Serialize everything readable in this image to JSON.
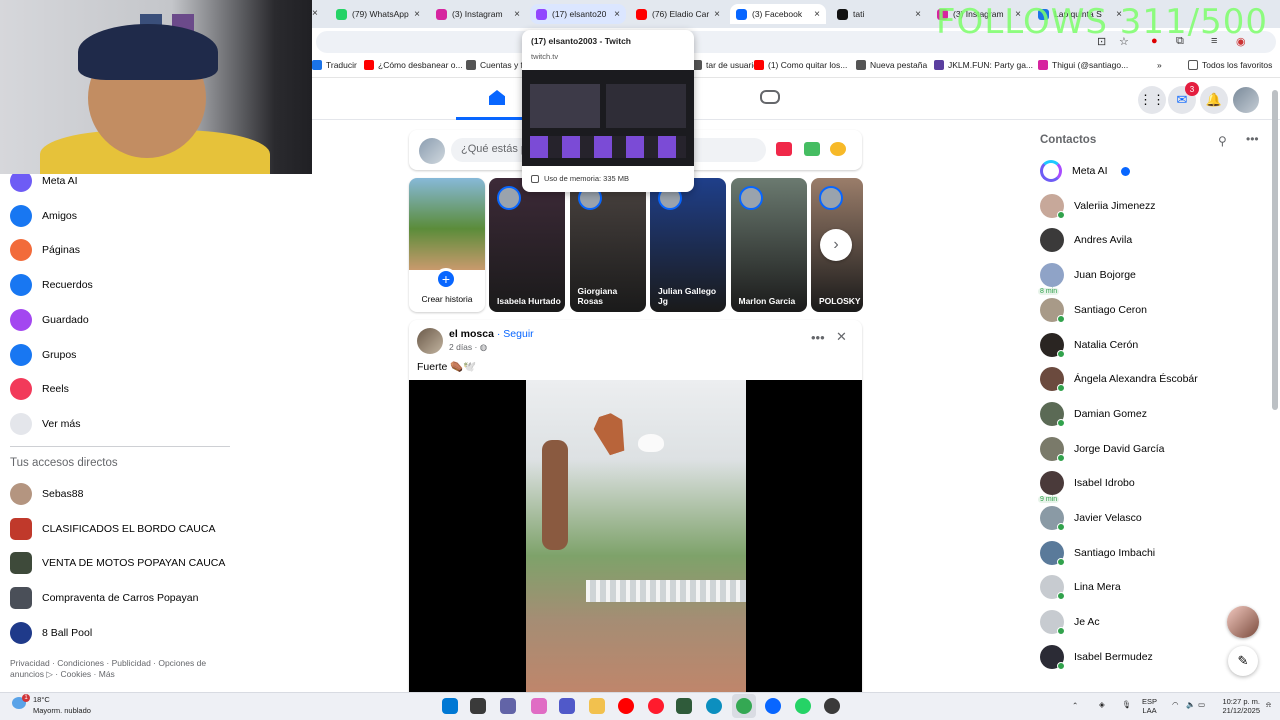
{
  "browser": {
    "tabs": [
      {
        "title": "(79) WhatsApp",
        "icon": "whatsapp-icon",
        "color": "#25d366",
        "state": "normal"
      },
      {
        "title": "(3) Instagram",
        "icon": "instagram-icon",
        "color": "#d6249f",
        "state": "normal"
      },
      {
        "title": "(17) elsanto20",
        "icon": "twitch-icon",
        "color": "#9146ff",
        "state": "hover"
      },
      {
        "title": "(76) Eladio Car",
        "icon": "youtube-icon",
        "color": "#ff0000",
        "state": "normal"
      },
      {
        "title": "(3) Facebook",
        "icon": "facebook-icon",
        "color": "#0866ff",
        "state": "active"
      },
      {
        "title": "tati",
        "icon": "tiktok-icon",
        "color": "#111111",
        "state": "normal"
      },
      {
        "title": "(3) Instagram",
        "icon": "instagram-icon",
        "color": "#d6249f",
        "state": "normal"
      },
      {
        "title": "Lap quinta S",
        "icon": "chrome-icon",
        "color": "#1a73e8",
        "state": "normal"
      }
    ],
    "tab_close": "×",
    "hover_card": {
      "title": "(17) elsanto2003 - Twitch",
      "url": "twitch.tv",
      "memory": "Uso de memoria: 335 MB"
    },
    "bookmarks": [
      {
        "label": "Traducir",
        "color": "#1a73e8"
      },
      {
        "label": "¿Cómo desbanear o...",
        "color": "#ff0000"
      },
      {
        "label": "Cuentas y fa",
        "color": "#555555"
      },
      {
        "label": "tar de usuario",
        "color": "#555555"
      },
      {
        "label": "(1) Como quitar los...",
        "color": "#ff0000"
      },
      {
        "label": "Nueva pestaña",
        "color": "#555555"
      },
      {
        "label": "JKLM.FUN: Party ga...",
        "color": "#5b3fa0"
      },
      {
        "label": "Thigui (@santiago...",
        "color": "#d6249f"
      }
    ],
    "bookmarks_more": "»",
    "all_bookmarks": "Todos los favoritos"
  },
  "overlay": {
    "follows": "FOLLOWS 311/500"
  },
  "facebook": {
    "composer_placeholder": "¿Qué estás p",
    "notification_count": "3",
    "left_nav": [
      {
        "label": "Meta AI",
        "icon": "meta-ai-icon",
        "color": "#6e5cf5"
      },
      {
        "label": "Amigos",
        "icon": "friends-icon",
        "color": "#1877f2"
      },
      {
        "label": "Páginas",
        "icon": "pages-icon",
        "color": "#f26b3a"
      },
      {
        "label": "Recuerdos",
        "icon": "memories-icon",
        "color": "#1877f2"
      },
      {
        "label": "Guardado",
        "icon": "saved-icon",
        "color": "#a347f0"
      },
      {
        "label": "Grupos",
        "icon": "groups-icon",
        "color": "#1877f2"
      },
      {
        "label": "Reels",
        "icon": "reels-icon",
        "color": "#f23a5a"
      },
      {
        "label": "Ver más",
        "icon": "chevron-down-icon",
        "color": "#e4e6eb"
      }
    ],
    "shortcuts_title": "Tus accesos directos",
    "shortcuts": [
      {
        "label": "Sebas88",
        "color": "#b49580"
      },
      {
        "label": "CLASIFICADOS EL BORDO CAUCA",
        "color": "#c0392b"
      },
      {
        "label": "VENTA DE MOTOS POPAYAN CAUCA",
        "color": "#3e4a3a"
      },
      {
        "label": "Compraventa de Carros Popayan",
        "color": "#4a4f58"
      },
      {
        "label": "8 Ball Pool",
        "color": "#1f3a8a"
      }
    ],
    "legal": "Privacidad · Condiciones · Publicidad · Opciones de anuncios ▷ · Cookies · Más",
    "stories": {
      "create_label": "Crear historia",
      "items": [
        {
          "name": "Isabela Hurtado",
          "color": "#3d2a38"
        },
        {
          "name": "Giorgiana Rosas",
          "color": "#4a4340"
        },
        {
          "name": "Julian Gallego Jg",
          "color": "#1f3f8a"
        },
        {
          "name": "Marlon Garcia",
          "color": "#6b7a70"
        },
        {
          "name": "POLOSKY",
          "color": "#9a7d6a"
        }
      ]
    },
    "post": {
      "author": "el mosca",
      "follow": "Seguir",
      "time": "2 días · ",
      "caption": "Fuerte ⚰️🕊️"
    },
    "contacts": {
      "title": "Contactos",
      "items": [
        {
          "name": "Meta AI",
          "kind": "meta",
          "color": "#6e5cf5",
          "online": false,
          "minutes": ""
        },
        {
          "name": "Valeriia Jimenezz",
          "kind": "person",
          "color": "#c7a89a",
          "online": true,
          "minutes": ""
        },
        {
          "name": "Andres Avila",
          "kind": "person",
          "color": "#3b3a3a",
          "online": false,
          "minutes": ""
        },
        {
          "name": "Juan Bojorge",
          "kind": "person",
          "color": "#8fa3c7",
          "online": false,
          "minutes": "8 min"
        },
        {
          "name": "Santiago Ceron",
          "kind": "person",
          "color": "#a89a88",
          "online": true,
          "minutes": ""
        },
        {
          "name": "Natalia Cerón",
          "kind": "person",
          "color": "#2a2522",
          "online": true,
          "minutes": ""
        },
        {
          "name": "Ángela Alexandra Éscobár",
          "kind": "person",
          "color": "#6b4a3e",
          "online": true,
          "minutes": ""
        },
        {
          "name": "Damian Gomez",
          "kind": "person",
          "color": "#5b6a55",
          "online": true,
          "minutes": ""
        },
        {
          "name": "Jorge David García",
          "kind": "person",
          "color": "#7a7a6a",
          "online": true,
          "minutes": ""
        },
        {
          "name": "Isabel Idrobo",
          "kind": "person",
          "color": "#4a3a3a",
          "online": false,
          "minutes": "9 min"
        },
        {
          "name": "Javier Velasco",
          "kind": "person",
          "color": "#8a9aa5",
          "online": true,
          "minutes": ""
        },
        {
          "name": "Santiago Imbachi",
          "kind": "person",
          "color": "#5a7a9a",
          "online": true,
          "minutes": ""
        },
        {
          "name": "Lina Mera",
          "kind": "person",
          "color": "#c7cbd0",
          "online": true,
          "minutes": ""
        },
        {
          "name": "Je Ac",
          "kind": "person",
          "color": "#c7cbd0",
          "online": true,
          "minutes": ""
        },
        {
          "name": "Isabel Bermudez",
          "kind": "person",
          "color": "#2b2b35",
          "online": true,
          "minutes": ""
        }
      ]
    }
  },
  "taskbar": {
    "weather_temp": "18°C",
    "weather_desc": "Mayorm. nublado",
    "weather_alert": "1",
    "lang_top": "ESP",
    "lang_bottom": "LAA",
    "time": "10:27 p. m.",
    "date": "21/12/2025",
    "apps": [
      {
        "icon": "windows-start-icon",
        "color": "#0078d4"
      },
      {
        "icon": "file-explorer-icon",
        "color": "#3a3a3a"
      },
      {
        "icon": "chat-icon",
        "color": "#6264a7"
      },
      {
        "icon": "copilot-icon",
        "color": "#e06cc4"
      },
      {
        "icon": "teams-icon",
        "color": "#5059c9"
      },
      {
        "icon": "folder-icon",
        "color": "#f2c14e"
      },
      {
        "icon": "youtube-icon",
        "color": "#ff0000"
      },
      {
        "icon": "opera-icon",
        "color": "#ff1b2d"
      },
      {
        "icon": "calculator-icon",
        "color": "#2f5b3a"
      },
      {
        "icon": "edge-icon",
        "color": "#0c8fbf"
      },
      {
        "icon": "chrome-icon",
        "color": "#34a853"
      },
      {
        "icon": "facebook-icon",
        "color": "#0866ff"
      },
      {
        "icon": "whatsapp-icon",
        "color": "#25d366"
      },
      {
        "icon": "obs-icon",
        "color": "#3a3a3a"
      }
    ]
  }
}
